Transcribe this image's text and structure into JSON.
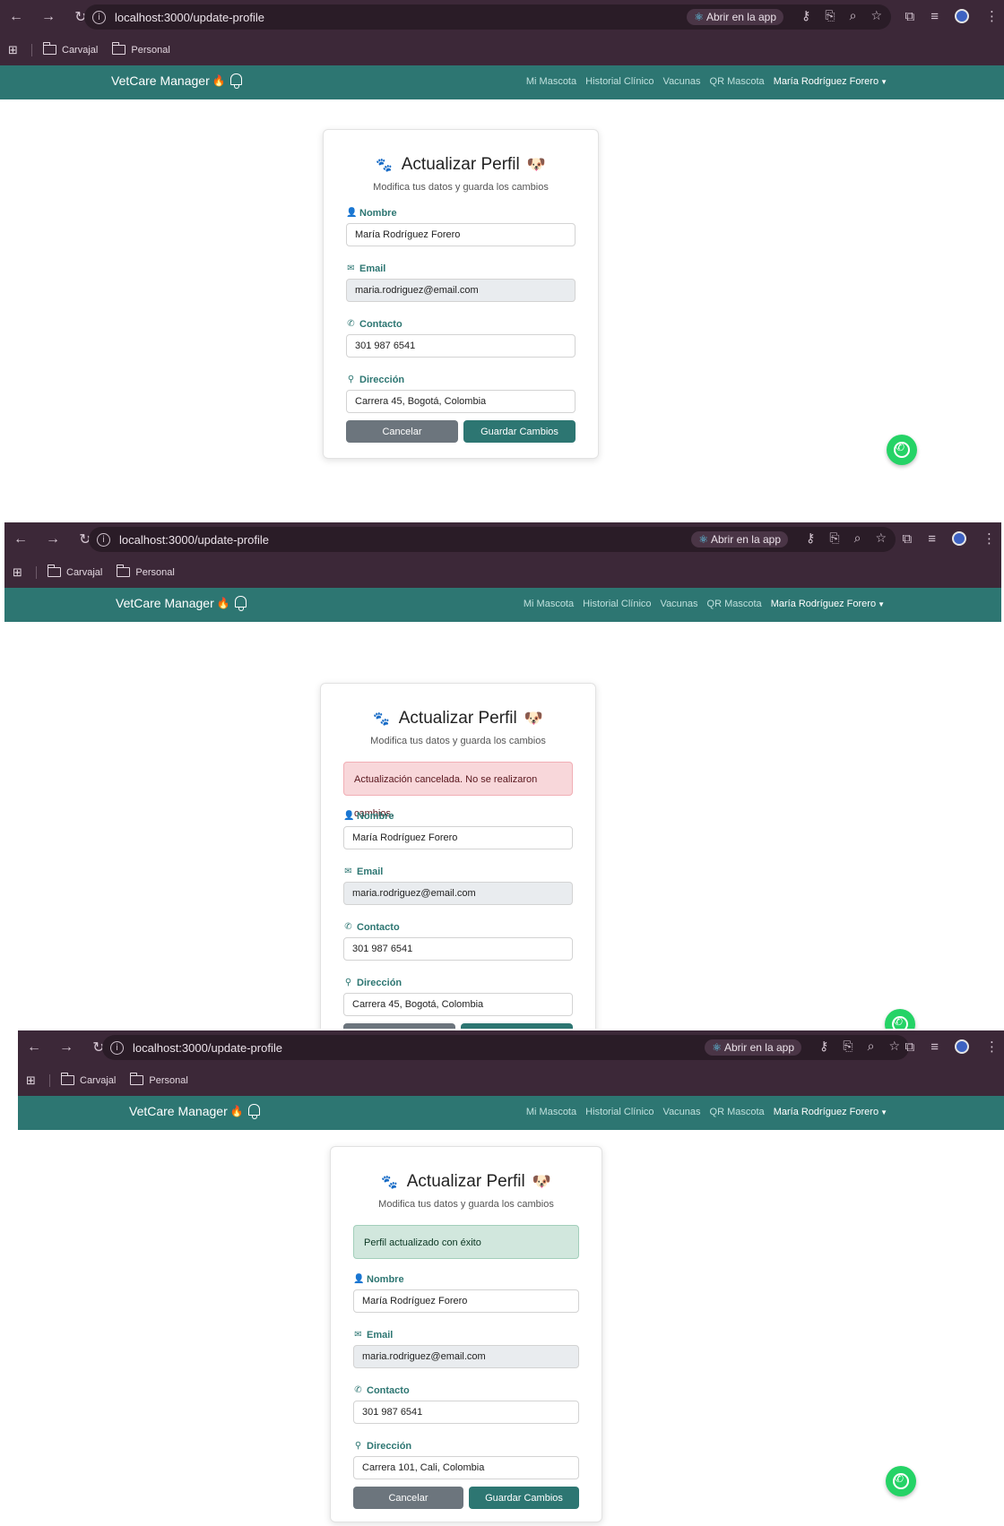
{
  "browser": {
    "url": "localhost:3000/update-profile",
    "open_app_label": "Abrir en la app",
    "bookmarks": [
      "Carvajal",
      "Personal"
    ]
  },
  "navbar": {
    "brand": "VetCare Manager",
    "links": [
      "Mi Mascota",
      "Historial Clínico",
      "Vacunas",
      "QR Mascota"
    ],
    "user": "María Rodríguez Forero"
  },
  "form": {
    "title": "Actualizar Perfil",
    "subtitle": "Modifica tus datos y guarda los cambios",
    "labels": {
      "nombre": "Nombre",
      "email": "Email",
      "contacto": "Contacto",
      "direccion": "Dirección"
    },
    "cancel_label": "Cancelar",
    "save_label": "Guardar Cambios"
  },
  "screens": [
    {
      "alert": null,
      "values": {
        "nombre": "María Rodríguez Forero",
        "email": "maria.rodriguez@email.com",
        "contacto": "301 987 6541",
        "direccion": "Carrera 45, Bogotá, Colombia"
      }
    },
    {
      "alert": {
        "type": "danger",
        "text": "Actualización cancelada. No se realizaron cambios."
      },
      "values": {
        "nombre": "María Rodríguez Forero",
        "email": "maria.rodriguez@email.com",
        "contacto": "301 987 6541",
        "direccion": "Carrera 45, Bogotá, Colombia"
      }
    },
    {
      "alert": {
        "type": "success",
        "text": "Perfil actualizado con éxito"
      },
      "values": {
        "nombre": "María Rodríguez Forero",
        "email": "maria.rodriguez@email.com",
        "contacto": "301 987 6541",
        "direccion": "Carrera 101, Cali, Colombia"
      }
    }
  ],
  "colors": {
    "browser_chrome": "#3c2838",
    "navbar": "#2d7672",
    "primary_button": "#2d7672",
    "secondary_button": "#6c757d",
    "whatsapp": "#25d366"
  },
  "icons": {
    "nombre": "user-icon",
    "email": "envelope-icon",
    "contacto": "phone-icon",
    "direccion": "map-marker-icon",
    "title_left": "paw-icon",
    "title_right": "dog-face-icon",
    "brand": "flame-icon",
    "floating": "whatsapp-icon"
  }
}
